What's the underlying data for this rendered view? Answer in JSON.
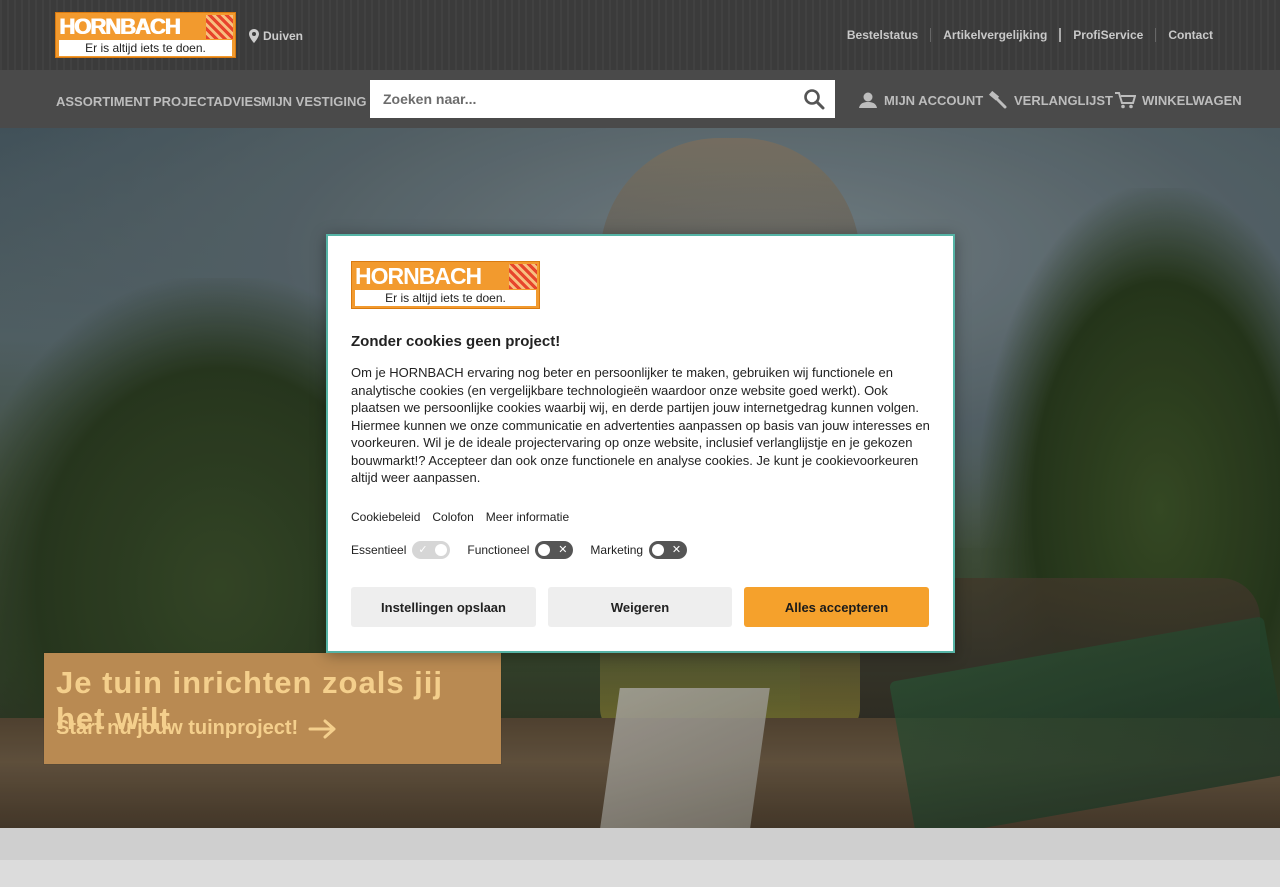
{
  "header": {
    "logo": {
      "word": "HORNBACH",
      "tagline": "Er is altijd iets te doen."
    },
    "location": "Duiven",
    "top_links": [
      "Bestelstatus",
      "Artikelvergelijking",
      "ProfiService",
      "Contact"
    ]
  },
  "nav": {
    "items": [
      "ASSORTIMENT",
      "PROJECTADVIES",
      "MIJN VESTIGING"
    ],
    "search": {
      "placeholder": "Zoeken naar..."
    },
    "account": "MIJN ACCOUNT",
    "wishlist": "VERLANGLIJST",
    "cart": "WINKELWAGEN"
  },
  "hero": {
    "headline": "Je tuin inrichten zoals jij het wilt",
    "cta": "Start nu jouw tuinproject!"
  },
  "cookie_modal": {
    "logo": {
      "word": "HORNBACH",
      "tagline": "Er is altijd iets te doen."
    },
    "title": "Zonder cookies geen project!",
    "body": "Om je HORNBACH ervaring nog beter en persoonlijker te maken, gebruiken wij functionele en analytische cookies (en vergelijkbare technologieën waardoor onze website goed werkt). Ook plaatsen we persoonlijke cookies waarbij wij, en derde partijen jouw internetgedrag kunnen volgen. Hiermee kunnen we onze communicatie en advertenties aanpassen op basis van jouw interesses en voorkeuren. Wil je de ideale projectervaring op onze website, inclusief verlanglijstje en je gekozen bouwmarkt!? Accepteer dan ook onze functionele en analyse cookies. Je kunt je cookievoorkeuren altijd weer aanpassen.",
    "links": [
      "Cookiebeleid",
      "Colofon",
      "Meer informatie"
    ],
    "toggles": [
      {
        "label": "Essentieel",
        "enabled": true,
        "mark": "✓"
      },
      {
        "label": "Functioneel",
        "enabled": false,
        "mark": "✕"
      },
      {
        "label": "Marketing",
        "enabled": false,
        "mark": "✕"
      }
    ],
    "buttons": {
      "save": "Instellingen opslaan",
      "deny": "Weigeren",
      "accept": "Alles accepteren"
    }
  },
  "colors": {
    "brand_orange": "#f29a2e",
    "accept_button": "#f5a12c",
    "modal_border": "#55b3a5",
    "header_dark": "#3b3b3b"
  }
}
